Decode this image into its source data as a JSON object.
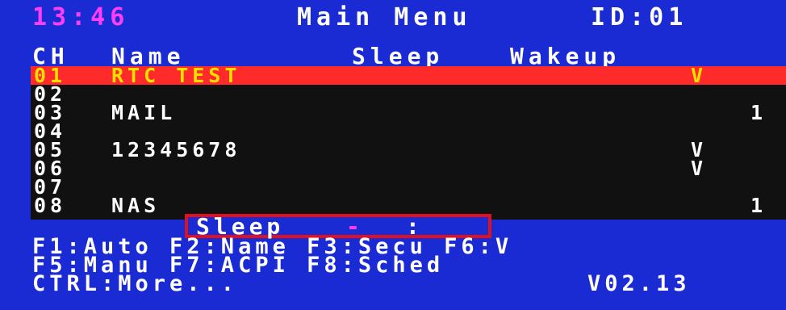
{
  "header": {
    "time": "13:46",
    "title": "Main Menu",
    "id": "ID:01"
  },
  "columns": {
    "ch": "CH",
    "name": "Name",
    "sleep": "Sleep",
    "wakeup": "Wakeup"
  },
  "channels": [
    {
      "ch": "01",
      "name": "RTC TEST",
      "wakeup": "V",
      "sleep": ""
    },
    {
      "ch": "02",
      "name": "",
      "wakeup": "",
      "sleep": ""
    },
    {
      "ch": "03",
      "name": "MAIL",
      "wakeup": "",
      "sleep": "1"
    },
    {
      "ch": "04",
      "name": "",
      "wakeup": "",
      "sleep": ""
    },
    {
      "ch": "05",
      "name": "12345678",
      "wakeup": "V",
      "sleep": ""
    },
    {
      "ch": "06",
      "name": "",
      "wakeup": "V",
      "sleep": ""
    },
    {
      "ch": "07",
      "name": "",
      "wakeup": "",
      "sleep": ""
    },
    {
      "ch": "08",
      "name": "NAS",
      "wakeup": "",
      "sleep": "1"
    }
  ],
  "sleep_popup": {
    "label": "Sleep",
    "value": "-",
    "separator": ":"
  },
  "function_keys": {
    "line1": "F1:Auto F2:Name F3:Secu F6:V",
    "line2": "F5:Manu F7:ACPI F8:Sched",
    "line3_left": "CTRL:More...",
    "version": "V02.13"
  },
  "colors": {
    "background": "#1b2bd4",
    "selection": "#ff2a2a",
    "highlight_text": "#ffe000",
    "time_color": "#ff3dff",
    "popup_border": "#e0101c"
  }
}
